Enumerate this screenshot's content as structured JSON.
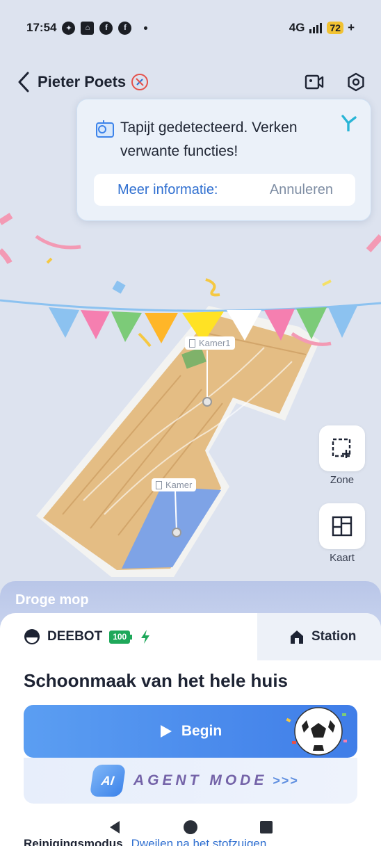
{
  "status_bar": {
    "time": "17:54",
    "network": "4G",
    "battery": "72",
    "battery_suffix": "+"
  },
  "header": {
    "title": "Pieter Poets"
  },
  "toast": {
    "message": "Tapijt gedetecteerd. Verken verwante functies!",
    "more_label": "Meer informatie:",
    "cancel_label": "Annuleren"
  },
  "map": {
    "rooms": [
      {
        "label": "Kamer1"
      },
      {
        "label": "Kamer"
      }
    ]
  },
  "side_controls": {
    "zone_label": "Zone",
    "map_label": "Kaart"
  },
  "mode_strip": {
    "label": "Droge mop"
  },
  "panel": {
    "robot_name": "DEEBOT",
    "battery": "100",
    "station_label": "Station",
    "clean_title": "Schoonmaak van het hele huis",
    "begin_label": "Begin",
    "ai_label": "AI",
    "agent_label": "AGENT MODE",
    "agent_chevrons": ">>>",
    "mode_key": "Reinigingsmodus",
    "mode_value": "Dweilen na het stofzuigen"
  },
  "colors": {
    "accent": "#3f7de8",
    "link": "#2f6fd0",
    "battery_green": "#1ea85a"
  }
}
